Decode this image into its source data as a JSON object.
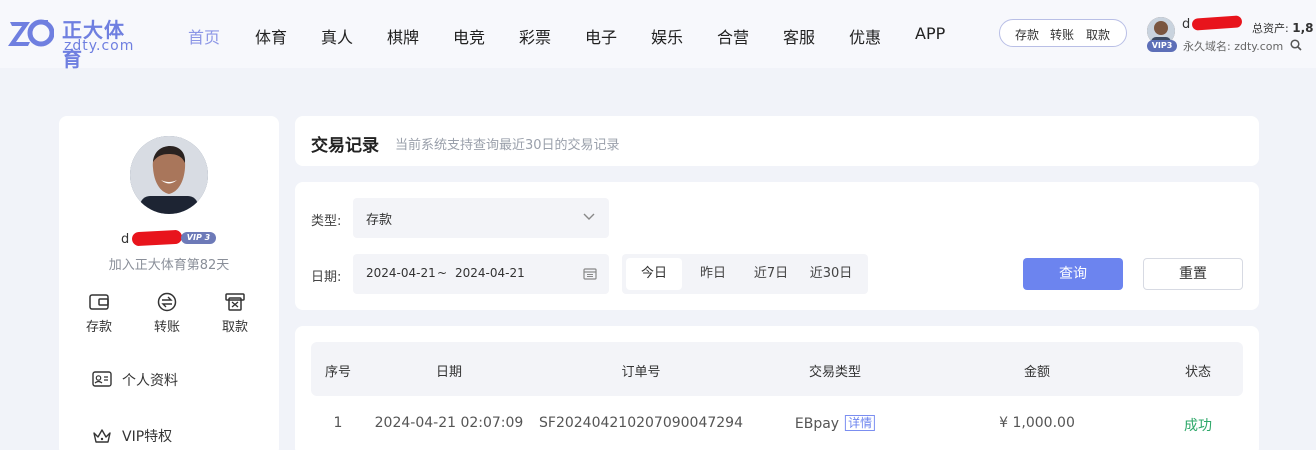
{
  "header": {
    "logo_cn": "正大体育",
    "logo_en": "zdty.com",
    "nav": [
      "首页",
      "体育",
      "真人",
      "棋牌",
      "电竞",
      "彩票",
      "电子",
      "娱乐",
      "合营",
      "客服",
      "优惠",
      "APP"
    ],
    "active_nav": "首页",
    "quick_actions": [
      "存款",
      "转账",
      "取款"
    ],
    "user_initial": "d",
    "vip_badge": "VIP3",
    "total_assets_label": "总资产:",
    "total_assets_value": "1,8",
    "domain_label": "永久域名: zdty.com"
  },
  "profile": {
    "name_prefix": "d",
    "vip": "VIP 3",
    "joined": "加入正大体育第82天",
    "actions": [
      "存款",
      "转账",
      "取款"
    ],
    "menu": [
      "个人资料",
      "VIP特权"
    ]
  },
  "page": {
    "title": "交易记录",
    "subtitle": "当前系统支持查询最近30日的交易记录"
  },
  "filters": {
    "type_label": "类型:",
    "type_value": "存款",
    "date_label": "日期:",
    "date_start": "2024-04-21",
    "date_sep": "~",
    "date_end": "2024-04-21",
    "ranges": [
      "今日",
      "昨日",
      "近7日",
      "近30日"
    ],
    "active_range": "今日",
    "query_label": "查询",
    "reset_label": "重置"
  },
  "table": {
    "columns": [
      "序号",
      "日期",
      "订单号",
      "交易类型",
      "金额",
      "状态"
    ],
    "rows": [
      {
        "index": "1",
        "date": "2024-04-21 02:07:09",
        "order_no": "SF20240421020709004729 4",
        "type": "EBpay",
        "detail": "详情",
        "amount": "¥ 1,000.00",
        "status": "成功"
      }
    ]
  },
  "colors": {
    "accent": "#6c84ef",
    "success": "#2fa86a",
    "background": "#f1f3f9"
  }
}
